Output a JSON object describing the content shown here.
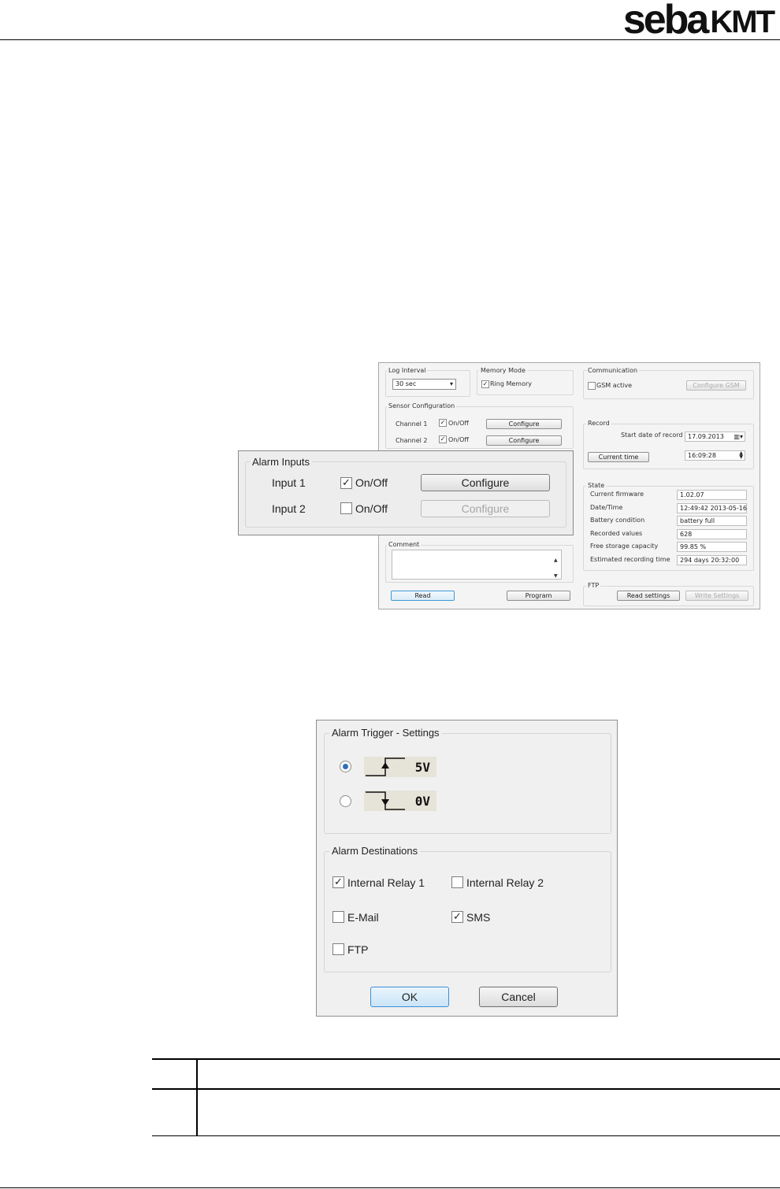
{
  "header": {
    "logo_part1": "seba",
    "logo_part2": "KMT"
  },
  "window": {
    "log_interval": {
      "title": "Log Interval",
      "value": "30 sec"
    },
    "memory_mode": {
      "title": "Memory Mode",
      "ring_memory_label": "Ring Memory",
      "ring_memory_checked": true
    },
    "communication": {
      "title": "Communication",
      "gsm_label": "GSM active",
      "configure_gsm": "Configure GSM"
    },
    "sensor_configuration": {
      "title": "Sensor Configuration",
      "channels": [
        {
          "label": "Channel 1",
          "onoff": "On/Off",
          "checked": true,
          "configure": "Configure"
        },
        {
          "label": "Channel 2",
          "onoff": "On/Off",
          "checked": true,
          "configure": "Configure"
        }
      ]
    },
    "record": {
      "title": "Record",
      "start_label": "Start date of record",
      "start_date": "17.09.2013",
      "current_time_button": "Current time",
      "time_value": "16:09:28"
    },
    "state": {
      "title": "State",
      "rows": [
        {
          "label": "Current firmware",
          "value": "1.02.07"
        },
        {
          "label": "Date/Time",
          "value": "12:49:42 2013-05-16"
        },
        {
          "label": "Battery condition",
          "value": "battery full"
        },
        {
          "label": "Recorded values",
          "value": "628"
        },
        {
          "label": "Free storage capacity",
          "value": "99.85 %"
        },
        {
          "label": "Estimated recording time",
          "value": "294 days 20:32:00"
        }
      ]
    },
    "comment": {
      "title": "Comment",
      "value": ""
    },
    "read_button": "Read",
    "program_button": "Program",
    "ftp": {
      "title": "FTP",
      "read_settings": "Read settings",
      "write_settings": "Write Settings"
    }
  },
  "alarm_inputs": {
    "title": "Alarm Inputs",
    "inputs": [
      {
        "label": "Input 1",
        "onoff": "On/Off",
        "checked": true,
        "configure": "Configure",
        "enabled": true
      },
      {
        "label": "Input 2",
        "onoff": "On/Off",
        "checked": false,
        "configure": "Configure",
        "enabled": false
      }
    ]
  },
  "dialog": {
    "trigger_title": "Alarm Trigger - Settings",
    "triggers": [
      {
        "value": "5V",
        "selected": true,
        "edge": "rising"
      },
      {
        "value": "0V",
        "selected": false,
        "edge": "falling"
      }
    ],
    "destinations_title": "Alarm Destinations",
    "destinations": [
      {
        "label": "Internal Relay 1",
        "checked": true
      },
      {
        "label": "Internal Relay 2",
        "checked": false
      },
      {
        "label": "E-Mail",
        "checked": false
      },
      {
        "label": "SMS",
        "checked": true
      },
      {
        "label": "FTP",
        "checked": false
      }
    ],
    "ok_button": "OK",
    "cancel_button": "Cancel"
  }
}
